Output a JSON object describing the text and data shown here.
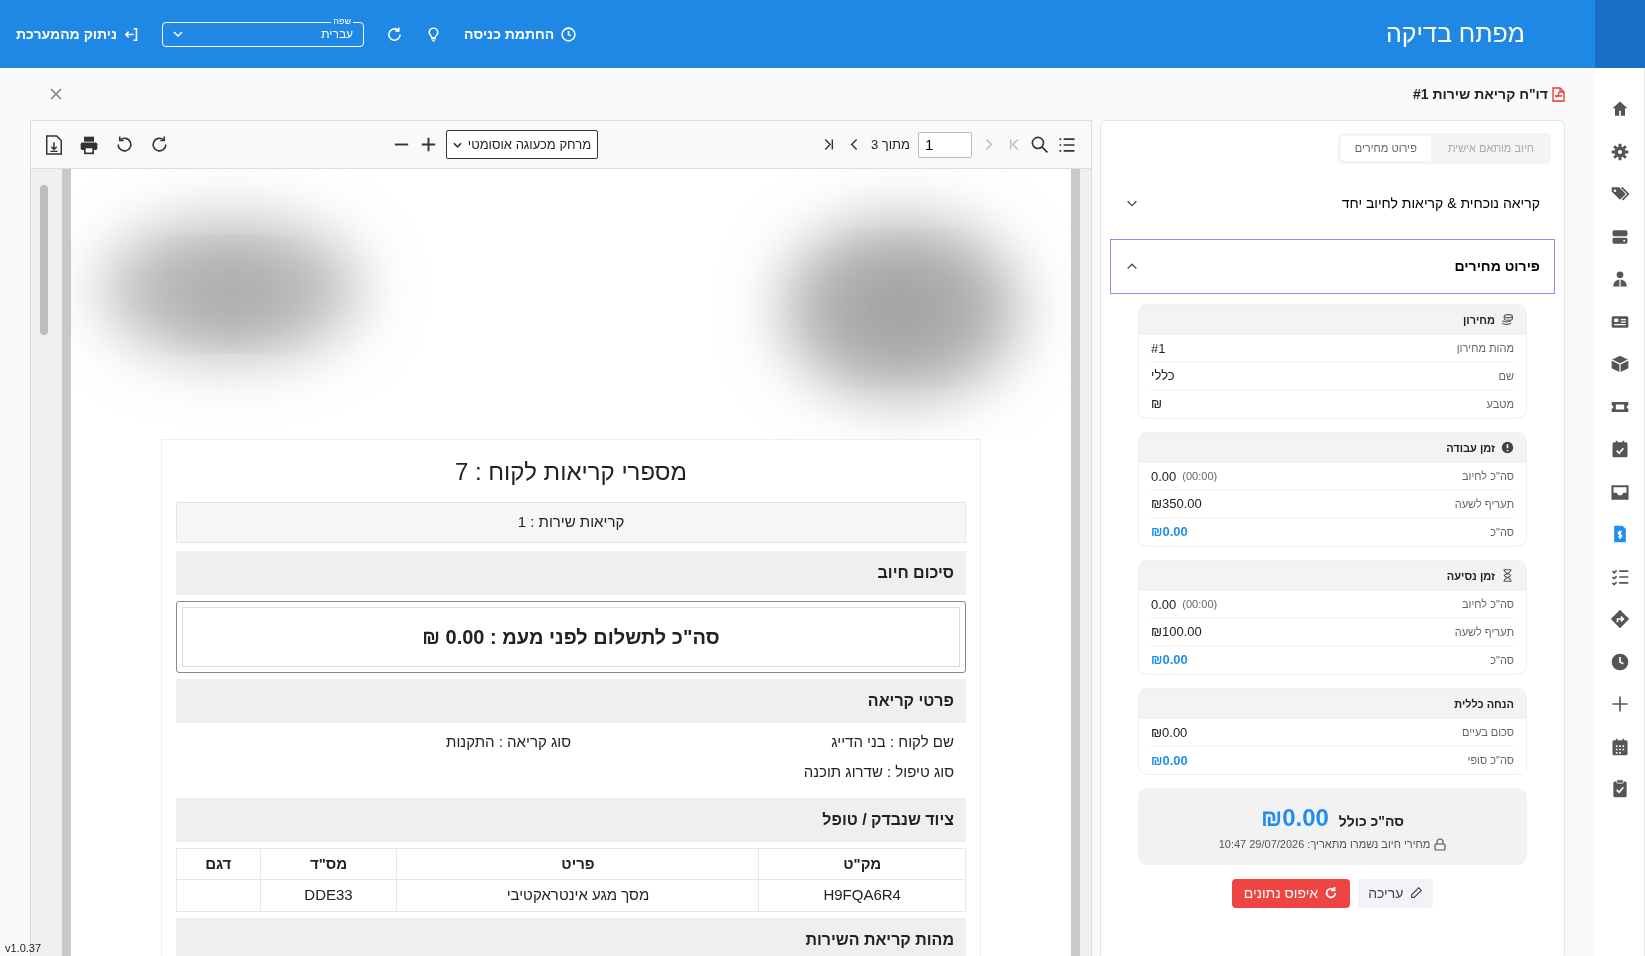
{
  "header": {
    "title": "מפתח בדיקה",
    "check_in": "החתמת כניסה",
    "language": {
      "label": "שפה",
      "value": "עברית"
    },
    "logout": "ניתוק מהמערכת"
  },
  "sidebar": {
    "items": [
      {
        "selected": false
      },
      {
        "selected": false
      },
      {
        "selected": false
      },
      {
        "selected": false
      },
      {
        "selected": false
      },
      {
        "selected": false
      },
      {
        "selected": false
      },
      {
        "selected": false
      },
      {
        "selected": false
      },
      {
        "selected": false
      },
      {
        "selected": true
      },
      {
        "selected": false
      },
      {
        "selected": false
      },
      {
        "selected": false
      },
      {
        "selected": false
      },
      {
        "selected": false
      },
      {
        "selected": false
      }
    ]
  },
  "document": {
    "title": "דו\"ח קריאת שירות #1"
  },
  "viewer": {
    "page": "1",
    "page_count": "מתוך 3",
    "zoom": "מרחק מכעוגה אוסומטי",
    "nav": [
      {
        "kind": "first",
        "disabled": true
      },
      {
        "kind": "prev",
        "disabled": true
      },
      {
        "kind": "next",
        "disabled": false
      },
      {
        "kind": "last",
        "disabled": false
      }
    ]
  },
  "report": {
    "title": "מספרי קריאות לקוח : 7",
    "calls": "קריאות שירות : 1",
    "sections": [
      {
        "kind": "header",
        "text": "סיכום חיוב"
      },
      {
        "kind": "total",
        "text": "סה\"כ לתשלום לפני מעמ : 0.00  ₪"
      },
      {
        "kind": "header",
        "text": "פרטי קריאה"
      },
      {
        "kind": "fields",
        "lines": [
          [
            "שם לקוח : בני הדייג",
            "סוג קריאה : התקנות"
          ],
          [
            "סוג טיפול : שדרוג תוכנה"
          ]
        ]
      },
      {
        "kind": "header",
        "text": "ציוד שנבדק / טופל"
      },
      {
        "kind": "table",
        "columns": [
          "מק\"ט",
          "פריט",
          "מס\"ד",
          "דגם"
        ],
        "rows": [
          [
            "H9FQA6R4",
            "מסך מגע אינטראקטיבי",
            "DDE33"
          ]
        ]
      },
      {
        "kind": "header",
        "text": "מהות קריאת השירות"
      }
    ]
  },
  "pricing": {
    "tabs": [
      {
        "label": "חיוב מותאם אישית",
        "selected": false
      },
      {
        "label": "פירוט מחירים",
        "selected": true
      }
    ],
    "accordions": [
      {
        "title": "קריאה נוכחית & קריאות לחיוב יחד",
        "expanded": false
      },
      {
        "title": "פירוט מחירים",
        "expanded": true
      }
    ],
    "cards": [
      {
        "title": "מחירון",
        "rows": [
          {
            "label": "מהות מחירון",
            "value": "#1",
            "kind": "plain"
          },
          {
            "label": "שם",
            "value": "כללי",
            "kind": "plain"
          },
          {
            "label": "מטבע",
            "value": "₪",
            "kind": "plain"
          }
        ]
      },
      {
        "title": "זמן עבודה",
        "rows": [
          {
            "label": "סה\"כ לחיוב",
            "value": "0.00",
            "note": "(00:00)",
            "kind": "plain"
          },
          {
            "label": "תעריף לשעה",
            "value": "₪350.00",
            "kind": "plain"
          },
          {
            "label": "סה\"כ",
            "value": "₪0.00",
            "kind": "total"
          }
        ]
      },
      {
        "title": "זמן נסיעה",
        "rows": [
          {
            "label": "סה\"כ לחיוב",
            "value": "0.00",
            "note": "(00:00)",
            "kind": "plain"
          },
          {
            "label": "תעריף לשעה",
            "value": "₪100.00",
            "kind": "plain"
          },
          {
            "label": "סה\"כ",
            "value": "₪0.00",
            "kind": "total"
          }
        ]
      },
      {
        "title": "הנחה כללית",
        "rows": [
          {
            "label": "סכום בעיים",
            "value": "₪0.00",
            "kind": "plain"
          },
          {
            "label": "סה\"כ סופי",
            "value": "₪0.00",
            "kind": "total"
          }
        ]
      }
    ],
    "grand_total": {
      "label": "סה\"כ כולל",
      "value": "₪0.00",
      "note": "מחירי חיוב נשמרו מתאריך: 29/07/2026 10:47"
    },
    "buttons": [
      {
        "kind": "edit",
        "label": "עריכה"
      },
      {
        "kind": "reset",
        "label": "איפוס נתונים"
      }
    ]
  },
  "version": "v1.0.37"
}
